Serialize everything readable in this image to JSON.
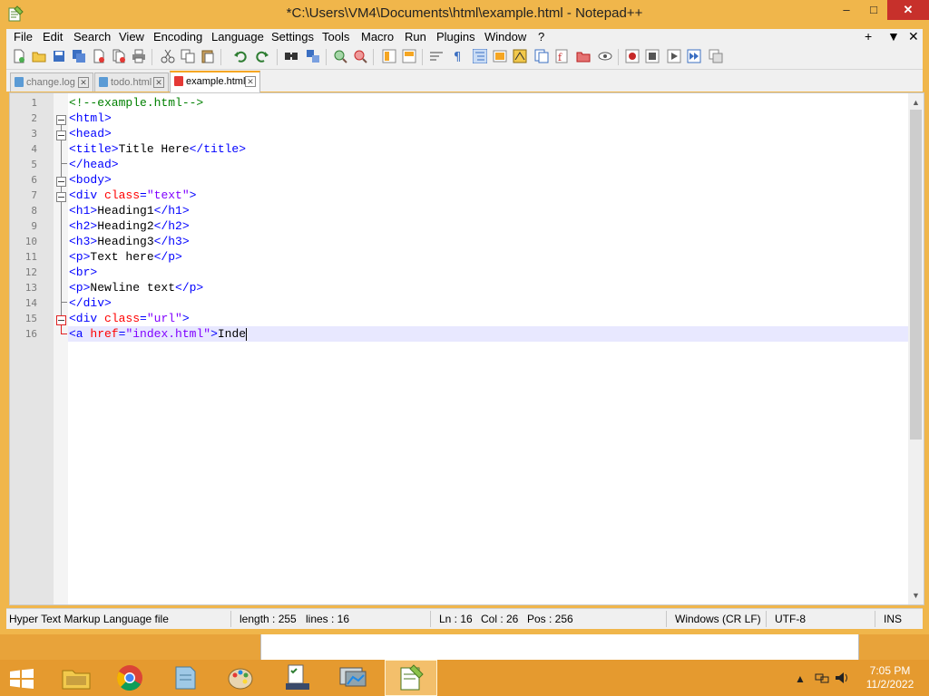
{
  "window": {
    "title": "*C:\\Users\\VM4\\Documents\\html\\example.html - Notepad++",
    "controls": {
      "minimize": "–",
      "maximize": "□",
      "close": "✕"
    }
  },
  "menu": {
    "items": [
      "File",
      "Edit",
      "Search",
      "View",
      "Encoding",
      "Language",
      "Settings",
      "Tools",
      "Macro",
      "Run",
      "Plugins",
      "Window",
      "?"
    ],
    "right": [
      "+",
      "▼",
      "✕"
    ]
  },
  "tabs": [
    {
      "label": "change.log",
      "active": false
    },
    {
      "label": "todo.html",
      "active": false
    },
    {
      "label": "example.html",
      "active": true
    }
  ],
  "editor": {
    "line_numbers": [
      "1",
      "2",
      "3",
      "4",
      "5",
      "6",
      "7",
      "8",
      "9",
      "10",
      "11",
      "12",
      "13",
      "14",
      "15",
      "16"
    ],
    "lines": [
      [
        {
          "t": "cmt",
          "s": "<!--example.html-->"
        }
      ],
      [
        {
          "t": "tag",
          "s": "<html>"
        }
      ],
      [
        {
          "t": "tag",
          "s": "<head>"
        }
      ],
      [
        {
          "t": "tag",
          "s": "<title>"
        },
        {
          "t": "txt",
          "s": "Title Here"
        },
        {
          "t": "tag",
          "s": "</title>"
        }
      ],
      [
        {
          "t": "tag",
          "s": "</head>"
        }
      ],
      [
        {
          "t": "tag",
          "s": "<body>"
        }
      ],
      [
        {
          "t": "tag",
          "s": "<div "
        },
        {
          "t": "attr",
          "s": "class"
        },
        {
          "t": "tag",
          "s": "="
        },
        {
          "t": "str",
          "s": "\"text\""
        },
        {
          "t": "tag",
          "s": ">"
        }
      ],
      [
        {
          "t": "tag",
          "s": "<h1>"
        },
        {
          "t": "txt",
          "s": "Heading1"
        },
        {
          "t": "tag",
          "s": "</h1>"
        }
      ],
      [
        {
          "t": "tag",
          "s": "<h2>"
        },
        {
          "t": "txt",
          "s": "Heading2"
        },
        {
          "t": "tag",
          "s": "</h2>"
        }
      ],
      [
        {
          "t": "tag",
          "s": "<h3>"
        },
        {
          "t": "txt",
          "s": "Heading3"
        },
        {
          "t": "tag",
          "s": "</h3>"
        }
      ],
      [
        {
          "t": "tag",
          "s": "<p>"
        },
        {
          "t": "txt",
          "s": "Text here"
        },
        {
          "t": "tag",
          "s": "</p>"
        }
      ],
      [
        {
          "t": "tag",
          "s": "<br>"
        }
      ],
      [
        {
          "t": "tag",
          "s": "<p>"
        },
        {
          "t": "txt",
          "s": "Newline text"
        },
        {
          "t": "tag",
          "s": "</p>"
        }
      ],
      [
        {
          "t": "tag",
          "s": "</div>"
        }
      ],
      [
        {
          "t": "tag",
          "s": "<div "
        },
        {
          "t": "attr",
          "s": "class"
        },
        {
          "t": "tag",
          "s": "="
        },
        {
          "t": "str",
          "s": "\"url\""
        },
        {
          "t": "tag",
          "s": ">"
        }
      ],
      [
        {
          "t": "tag",
          "s": "<a "
        },
        {
          "t": "attr",
          "s": "href"
        },
        {
          "t": "tag",
          "s": "="
        },
        {
          "t": "str",
          "s": "\"index.html\""
        },
        {
          "t": "tag",
          "s": ">"
        },
        {
          "t": "txt",
          "s": "Inde"
        }
      ]
    ],
    "current_line": 16
  },
  "status": {
    "file_type": "Hyper Text Markup Language file",
    "length": "length : 255",
    "lines": "lines : 16",
    "ln": "Ln : 16",
    "col": "Col : 26",
    "pos": "Pos : 256",
    "eol": "Windows (CR LF)",
    "encoding": "UTF-8",
    "mode": "INS"
  },
  "taskbar": {
    "clock_time": "7:05 PM",
    "clock_date": "11/2/2022"
  },
  "colors": {
    "accent": "#f0b64b",
    "tag": "#0000ff",
    "attr": "#ff0000",
    "string": "#8000ff",
    "comment": "#008000",
    "current_line": "#e8e8ff"
  }
}
